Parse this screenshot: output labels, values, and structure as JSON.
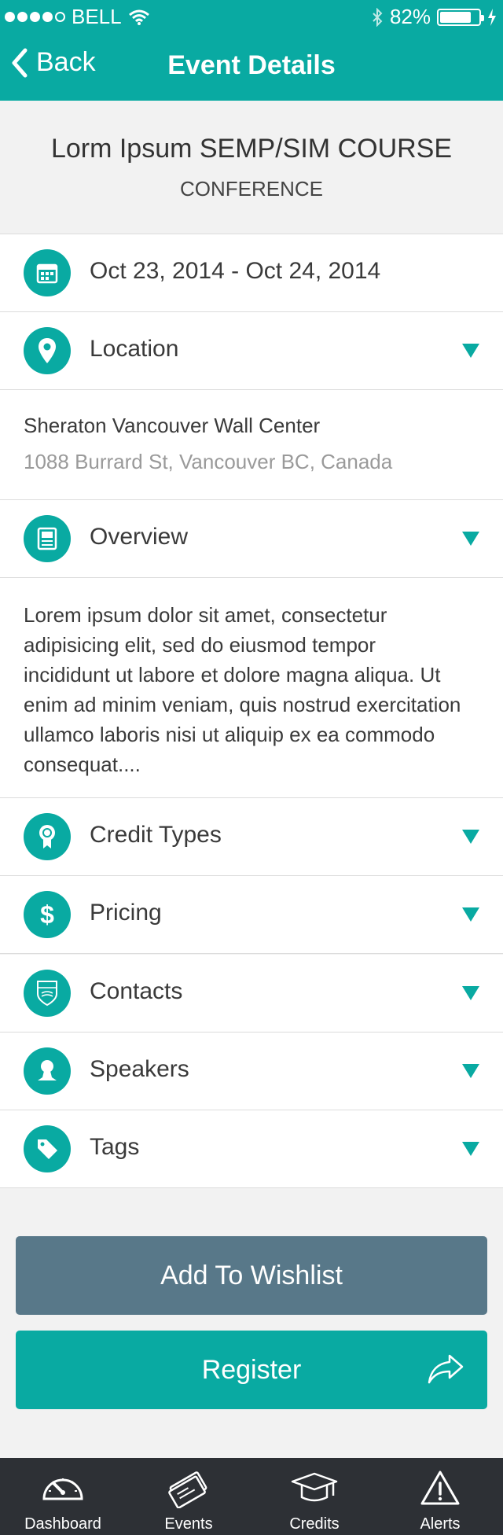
{
  "status_bar": {
    "carrier": "BELL",
    "battery_percent": "82%",
    "battery_level": 0.82,
    "signal_dots_filled": 4,
    "icons": [
      "wifi-icon",
      "bluetooth-icon",
      "battery-icon",
      "charging-bolt-icon"
    ]
  },
  "nav": {
    "back_label": "Back",
    "title": "Event Details"
  },
  "event": {
    "title": "Lorm Ipsum SEMP/SIM COURSE",
    "type": "CONFERENCE"
  },
  "rows": {
    "date": {
      "label": "Oct 23, 2014 - Oct 24, 2014",
      "icon": "calendar-icon"
    },
    "location": {
      "label": "Location",
      "icon": "location-pin-icon"
    },
    "overview": {
      "label": "Overview",
      "icon": "document-icon"
    },
    "credit_types": {
      "label": "Credit Types",
      "icon": "award-ribbon-icon"
    },
    "pricing": {
      "label": "Pricing",
      "icon": "dollar-icon"
    },
    "contacts": {
      "label": "Contacts",
      "icon": "ubc-crest-icon"
    },
    "speakers": {
      "label": "Speakers",
      "icon": "person-icon"
    },
    "tags": {
      "label": "Tags",
      "icon": "tag-icon"
    }
  },
  "location_detail": {
    "name": "Sheraton Vancouver Wall Center",
    "address": "1088 Burrard St, Vancouver BC, Canada"
  },
  "overview_detail": {
    "text": "Lorem ipsum dolor sit amet, consectetur adipisicing elit, sed do eiusmod tempor incididunt ut labore et dolore magna aliqua. Ut enim ad minim veniam, quis nostrud exercitation ullamco laboris nisi ut aliquip ex ea commodo consequat...."
  },
  "buttons": {
    "wishlist": "Add To Wishlist",
    "register": "Register"
  },
  "tabs": [
    {
      "label": "Dashboard",
      "icon": "dashboard-gauge-icon"
    },
    {
      "label": "Events",
      "icon": "tickets-icon"
    },
    {
      "label": "Credits",
      "icon": "graduation-cap-icon"
    },
    {
      "label": "Alerts",
      "icon": "warning-triangle-icon"
    }
  ],
  "colors": {
    "accent": "#09aaa2",
    "wishlist": "#587889",
    "tab_bar": "#2d3035"
  }
}
